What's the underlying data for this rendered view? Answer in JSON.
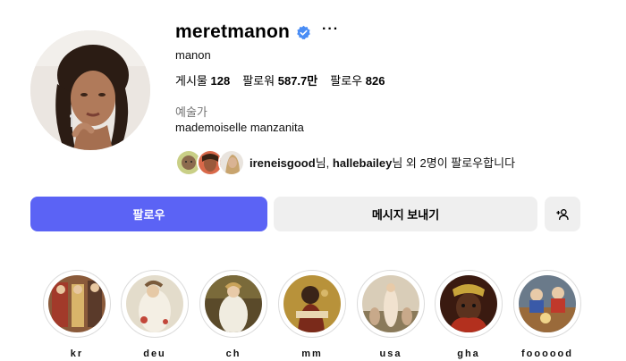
{
  "profile": {
    "username": "meretmanon",
    "verified": true,
    "full_name": "manon",
    "category": "예술가",
    "bio": "mademoiselle manzanita"
  },
  "stats": {
    "posts_label": "게시물",
    "posts_value": "128",
    "followers_label": "팔로워",
    "followers_value": "587.7만",
    "following_label": "팔로우",
    "following_value": "826"
  },
  "followed_by": {
    "user1": "ireneisgood",
    "suffix1": "님, ",
    "user2": "hallebailey",
    "suffix2": "님 외 2명이 팔로우합니다"
  },
  "actions": {
    "follow_label": "팔로우",
    "message_label": "메시지 보내기"
  },
  "highlights": [
    {
      "label": "kr"
    },
    {
      "label": "deu"
    },
    {
      "label": "ch"
    },
    {
      "label": "mm"
    },
    {
      "label": "usa"
    },
    {
      "label": "gha"
    },
    {
      "label": "foooood"
    }
  ],
  "colors": {
    "follow_button": "#5b63f5",
    "verified_badge": "#4a8df5",
    "secondary_button": "#efefef",
    "muted_text": "#737373"
  }
}
